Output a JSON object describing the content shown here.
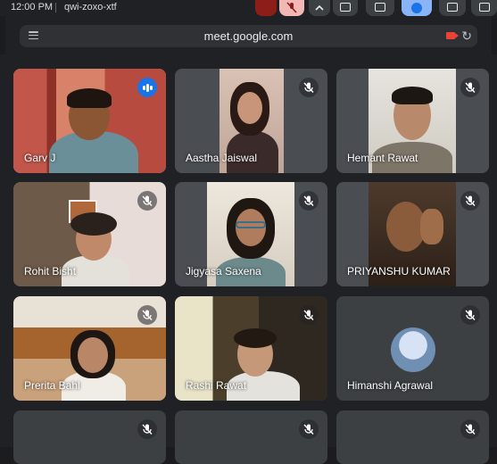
{
  "status": {
    "time": "12:00 PM",
    "meeting_code": "qwi-zoxo-xtf"
  },
  "browser": {
    "url": "meet.google.com"
  },
  "participants": [
    {
      "name": "Garv J",
      "speaking": true,
      "muted": false
    },
    {
      "name": "Aastha Jaiswal",
      "speaking": false,
      "muted": true
    },
    {
      "name": "Hemant Rawat",
      "speaking": false,
      "muted": true
    },
    {
      "name": "Rohit Bisht",
      "speaking": false,
      "muted": true
    },
    {
      "name": "Jigyasa Saxena",
      "speaking": false,
      "muted": true
    },
    {
      "name": "PRIYANSHU KUMAR",
      "speaking": false,
      "muted": true
    },
    {
      "name": "Prerita Bahl",
      "speaking": false,
      "muted": true
    },
    {
      "name": "Rashi Rawat",
      "speaking": false,
      "muted": true
    },
    {
      "name": "Himanshi Agrawal",
      "speaking": false,
      "muted": true
    },
    {
      "name": "",
      "speaking": false,
      "muted": true
    },
    {
      "name": "",
      "speaking": false,
      "muted": true
    },
    {
      "name": "",
      "speaking": false,
      "muted": true
    }
  ],
  "colors": {
    "accent": "#8ab4f8",
    "speaking_badge": "#1a73e8",
    "camera_indicator": "#ea4335"
  }
}
